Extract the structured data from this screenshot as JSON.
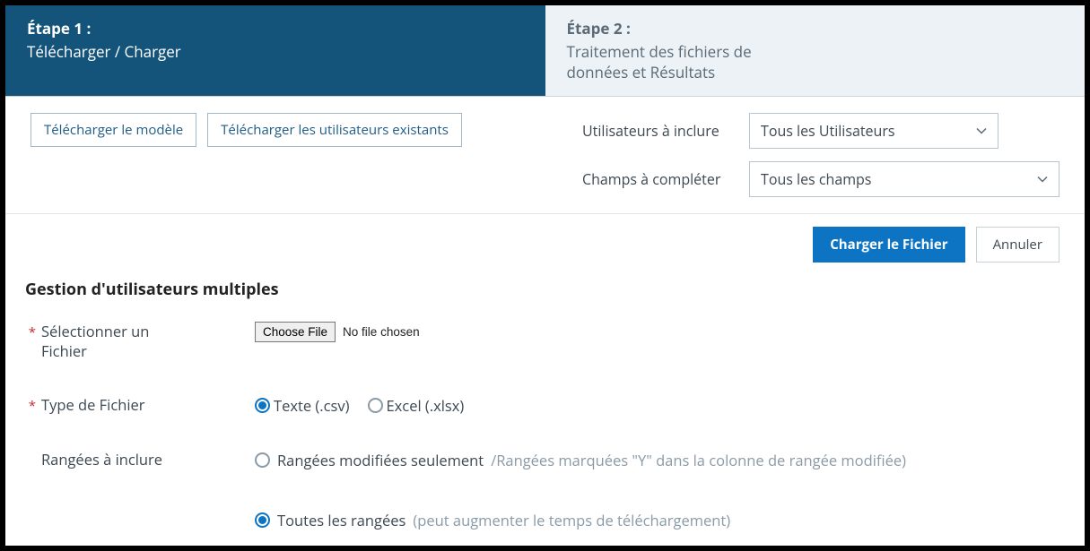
{
  "steps": {
    "step1": {
      "title": "Étape 1 :",
      "subtitle": "Télécharger / Charger"
    },
    "step2": {
      "title": "Étape 2 :",
      "subtitle": "Traitement des fichiers de données et Résultats"
    }
  },
  "toolbar": {
    "download_template": "Télécharger le modèle",
    "download_existing": "Télécharger les utilisateurs existants",
    "users_label": "Utilisateurs à inclure",
    "users_value": "Tous les Utilisateurs",
    "fields_label": "Champs à compléter",
    "fields_value": "Tous les champs"
  },
  "actions": {
    "upload": "Charger le Fichier",
    "cancel": "Annuler"
  },
  "section": {
    "title": "Gestion d'utilisateurs multiples"
  },
  "form": {
    "select_file_label": "Sélectionner un Fichier",
    "choose_file_btn": "Choose File",
    "no_file": "No file chosen",
    "file_type_label": "Type de Fichier",
    "file_type_options": {
      "csv": "Texte (.csv)",
      "xlsx": "Excel (.xlsx)"
    },
    "rows_label": "Rangées à inclure",
    "rows_options": {
      "modified": "Rangées modifiées seulement",
      "modified_hint": "/Rangées marquées \"Y\" dans la colonne de rangée modifiée)",
      "all": "Toutes les rangées",
      "all_hint": "(peut augmenter le temps de téléchargement)"
    }
  }
}
